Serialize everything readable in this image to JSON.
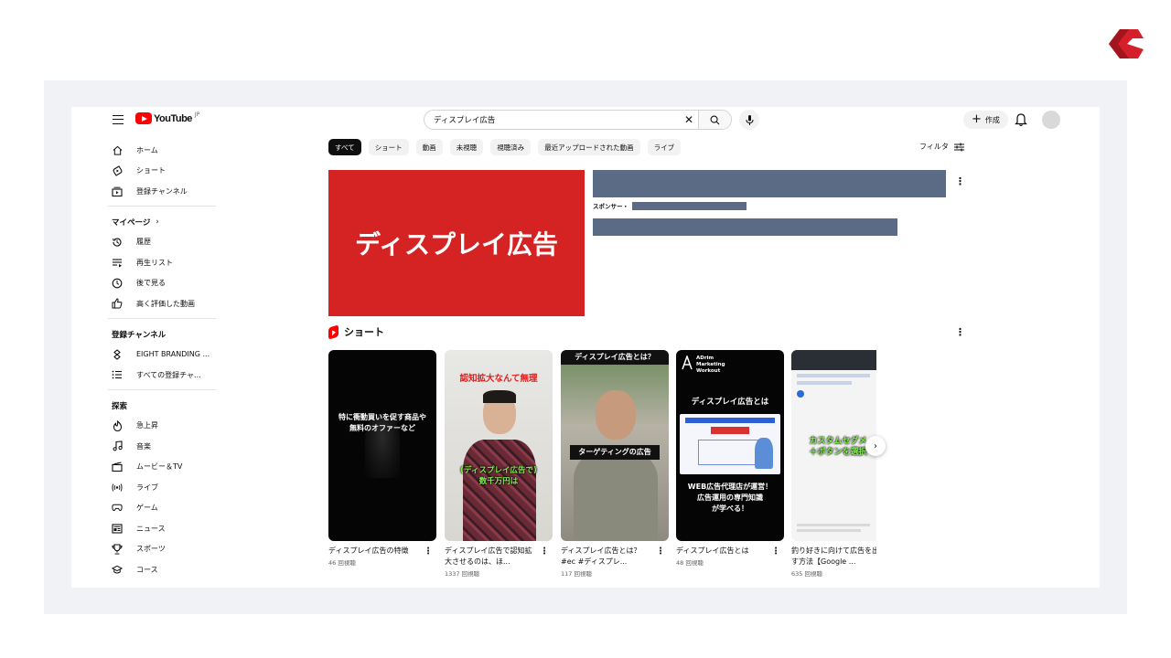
{
  "header": {
    "logo_text": "YouTube",
    "logo_sup": "JP",
    "search_value": "ディスプレイ広告",
    "create_label": "作成"
  },
  "sidebar": {
    "main": [
      {
        "label": "ホーム",
        "icon": "home-icon"
      },
      {
        "label": "ショート",
        "icon": "shorts-icon"
      },
      {
        "label": "登録チャンネル",
        "icon": "subscriptions-icon"
      }
    ],
    "you_heading": "マイページ",
    "you": [
      {
        "label": "履歴",
        "icon": "history-icon"
      },
      {
        "label": "再生リスト",
        "icon": "playlist-icon"
      },
      {
        "label": "後で見る",
        "icon": "clock-icon"
      },
      {
        "label": "高く評価した動画",
        "icon": "thumbs-up-icon"
      }
    ],
    "subs_heading": "登録チャンネル",
    "subs": [
      {
        "label": "EIGHT BRANDING ...",
        "icon": "channel-icon"
      },
      {
        "label": "すべての登録チャ...",
        "icon": "list-icon"
      }
    ],
    "explore_heading": "探索",
    "explore": [
      {
        "label": "急上昇",
        "icon": "trending-icon"
      },
      {
        "label": "音楽",
        "icon": "music-icon"
      },
      {
        "label": "ムービー＆TV",
        "icon": "movie-icon"
      },
      {
        "label": "ライブ",
        "icon": "live-icon"
      },
      {
        "label": "ゲーム",
        "icon": "gaming-icon"
      },
      {
        "label": "ニュース",
        "icon": "news-icon"
      },
      {
        "label": "スポーツ",
        "icon": "trophy-icon"
      },
      {
        "label": "コース",
        "icon": "course-icon"
      }
    ]
  },
  "chips": [
    "すべて",
    "ショート",
    "動画",
    "未視聴",
    "視聴済み",
    "最近アップロードされた動画",
    "ライブ"
  ],
  "filter_label": "フィルタ",
  "ad": {
    "thumb_text": "ディスプレイ広告",
    "sponsor_label": "スポンサー・"
  },
  "shorts": {
    "heading": "ショート",
    "items": [
      {
        "title": "ディスプレイ広告の特徴",
        "views": "46 回視聴",
        "overlay": [
          "特に衝動買いを促す商品や",
          "無料のオファーなど"
        ]
      },
      {
        "title": "ディスプレイ広告で認知拡大させるのは、ほ...",
        "views": "1337 回視聴",
        "overlay_top": "認知拡大なんて無理",
        "overlay_bottom": [
          "(ディスプレイ広告で)",
          "数千万円は"
        ]
      },
      {
        "title": "ディスプレイ広告とは？#ec #ディスプレ...",
        "views": "117 回視聴",
        "overlay_top": "ディスプレイ広告とは？",
        "overlay_mid": "ターゲティングの広告"
      },
      {
        "title": "ディスプレイ広告とは",
        "views": "48 回視聴",
        "overlay_logo": [
          "ADrim",
          "Marketing",
          "Workout"
        ],
        "overlay_top": "ディスプレイ広告とは",
        "overlay_bottom": [
          "WEB広告代理店が運営！",
          "広告運用の専門知識",
          "が学べる！"
        ]
      },
      {
        "title": "釣り好きに向けて広告を出す方法【Google ...",
        "views": "635 回視聴",
        "overlay_mid": [
          "カスタムセグメ",
          "＋ボタンを選択"
        ]
      }
    ]
  },
  "colors": {
    "brand_red": "#ff0000",
    "ad_red": "#d52323",
    "redacted": "#5b6b85",
    "frame": "#f1f2f5"
  }
}
